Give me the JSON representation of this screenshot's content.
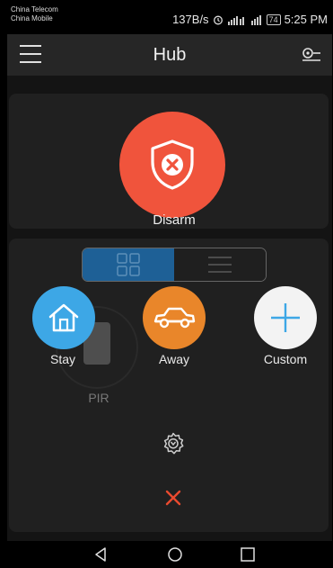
{
  "status_bar": {
    "carrier1": "China Telecom",
    "carrier2": "China Mobile",
    "net_speed": "137B/s",
    "battery": "74",
    "time": "5:25 PM"
  },
  "header": {
    "title": "Hub",
    "menu_icon": "hamburger-menu-icon",
    "right_icon": "hub-settings-icon"
  },
  "disarm": {
    "ghost_label": "Disarm",
    "label": "Disarm",
    "color": "#f0543c",
    "icon": "shield-x-icon"
  },
  "view_toggle": {
    "grid_icon": "grid-view-icon",
    "list_icon": "list-view-icon",
    "active": "grid",
    "active_color": "#1e6096"
  },
  "device": {
    "label": "PIR"
  },
  "modes": [
    {
      "label": "Stay",
      "icon": "home-icon",
      "color": "#3da7e6"
    },
    {
      "label": "Away",
      "icon": "car-icon",
      "color": "#e9862a"
    },
    {
      "label": "Custom",
      "icon": "plus-icon",
      "color": "#f3f3f3"
    }
  ],
  "actions": {
    "settings_icon": "settings-icon",
    "close_icon": "close-icon",
    "close_color": "#e94a2e"
  },
  "nav": {
    "back_icon": "back-icon",
    "home_icon": "home-nav-icon",
    "recent_icon": "recent-apps-icon"
  }
}
